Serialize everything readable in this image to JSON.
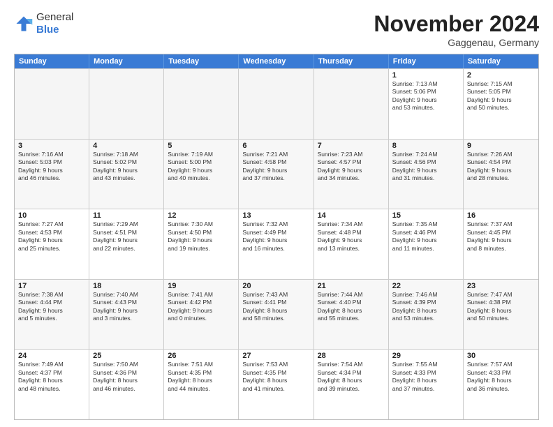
{
  "logo": {
    "general": "General",
    "blue": "Blue"
  },
  "header": {
    "month": "November 2024",
    "location": "Gaggenau, Germany"
  },
  "weekdays": [
    "Sunday",
    "Monday",
    "Tuesday",
    "Wednesday",
    "Thursday",
    "Friday",
    "Saturday"
  ],
  "rows": [
    [
      {
        "day": "",
        "empty": true
      },
      {
        "day": "",
        "empty": true
      },
      {
        "day": "",
        "empty": true
      },
      {
        "day": "",
        "empty": true
      },
      {
        "day": "",
        "empty": true
      },
      {
        "day": "1",
        "info": "Sunrise: 7:13 AM\nSunset: 5:06 PM\nDaylight: 9 hours\nand 53 minutes."
      },
      {
        "day": "2",
        "info": "Sunrise: 7:15 AM\nSunset: 5:05 PM\nDaylight: 9 hours\nand 50 minutes."
      }
    ],
    [
      {
        "day": "3",
        "info": "Sunrise: 7:16 AM\nSunset: 5:03 PM\nDaylight: 9 hours\nand 46 minutes."
      },
      {
        "day": "4",
        "info": "Sunrise: 7:18 AM\nSunset: 5:02 PM\nDaylight: 9 hours\nand 43 minutes."
      },
      {
        "day": "5",
        "info": "Sunrise: 7:19 AM\nSunset: 5:00 PM\nDaylight: 9 hours\nand 40 minutes."
      },
      {
        "day": "6",
        "info": "Sunrise: 7:21 AM\nSunset: 4:58 PM\nDaylight: 9 hours\nand 37 minutes."
      },
      {
        "day": "7",
        "info": "Sunrise: 7:23 AM\nSunset: 4:57 PM\nDaylight: 9 hours\nand 34 minutes."
      },
      {
        "day": "8",
        "info": "Sunrise: 7:24 AM\nSunset: 4:56 PM\nDaylight: 9 hours\nand 31 minutes."
      },
      {
        "day": "9",
        "info": "Sunrise: 7:26 AM\nSunset: 4:54 PM\nDaylight: 9 hours\nand 28 minutes."
      }
    ],
    [
      {
        "day": "10",
        "info": "Sunrise: 7:27 AM\nSunset: 4:53 PM\nDaylight: 9 hours\nand 25 minutes."
      },
      {
        "day": "11",
        "info": "Sunrise: 7:29 AM\nSunset: 4:51 PM\nDaylight: 9 hours\nand 22 minutes."
      },
      {
        "day": "12",
        "info": "Sunrise: 7:30 AM\nSunset: 4:50 PM\nDaylight: 9 hours\nand 19 minutes."
      },
      {
        "day": "13",
        "info": "Sunrise: 7:32 AM\nSunset: 4:49 PM\nDaylight: 9 hours\nand 16 minutes."
      },
      {
        "day": "14",
        "info": "Sunrise: 7:34 AM\nSunset: 4:48 PM\nDaylight: 9 hours\nand 13 minutes."
      },
      {
        "day": "15",
        "info": "Sunrise: 7:35 AM\nSunset: 4:46 PM\nDaylight: 9 hours\nand 11 minutes."
      },
      {
        "day": "16",
        "info": "Sunrise: 7:37 AM\nSunset: 4:45 PM\nDaylight: 9 hours\nand 8 minutes."
      }
    ],
    [
      {
        "day": "17",
        "info": "Sunrise: 7:38 AM\nSunset: 4:44 PM\nDaylight: 9 hours\nand 5 minutes."
      },
      {
        "day": "18",
        "info": "Sunrise: 7:40 AM\nSunset: 4:43 PM\nDaylight: 9 hours\nand 3 minutes."
      },
      {
        "day": "19",
        "info": "Sunrise: 7:41 AM\nSunset: 4:42 PM\nDaylight: 9 hours\nand 0 minutes."
      },
      {
        "day": "20",
        "info": "Sunrise: 7:43 AM\nSunset: 4:41 PM\nDaylight: 8 hours\nand 58 minutes."
      },
      {
        "day": "21",
        "info": "Sunrise: 7:44 AM\nSunset: 4:40 PM\nDaylight: 8 hours\nand 55 minutes."
      },
      {
        "day": "22",
        "info": "Sunrise: 7:46 AM\nSunset: 4:39 PM\nDaylight: 8 hours\nand 53 minutes."
      },
      {
        "day": "23",
        "info": "Sunrise: 7:47 AM\nSunset: 4:38 PM\nDaylight: 8 hours\nand 50 minutes."
      }
    ],
    [
      {
        "day": "24",
        "info": "Sunrise: 7:49 AM\nSunset: 4:37 PM\nDaylight: 8 hours\nand 48 minutes."
      },
      {
        "day": "25",
        "info": "Sunrise: 7:50 AM\nSunset: 4:36 PM\nDaylight: 8 hours\nand 46 minutes."
      },
      {
        "day": "26",
        "info": "Sunrise: 7:51 AM\nSunset: 4:35 PM\nDaylight: 8 hours\nand 44 minutes."
      },
      {
        "day": "27",
        "info": "Sunrise: 7:53 AM\nSunset: 4:35 PM\nDaylight: 8 hours\nand 41 minutes."
      },
      {
        "day": "28",
        "info": "Sunrise: 7:54 AM\nSunset: 4:34 PM\nDaylight: 8 hours\nand 39 minutes."
      },
      {
        "day": "29",
        "info": "Sunrise: 7:55 AM\nSunset: 4:33 PM\nDaylight: 8 hours\nand 37 minutes."
      },
      {
        "day": "30",
        "info": "Sunrise: 7:57 AM\nSunset: 4:33 PM\nDaylight: 8 hours\nand 36 minutes."
      }
    ]
  ]
}
